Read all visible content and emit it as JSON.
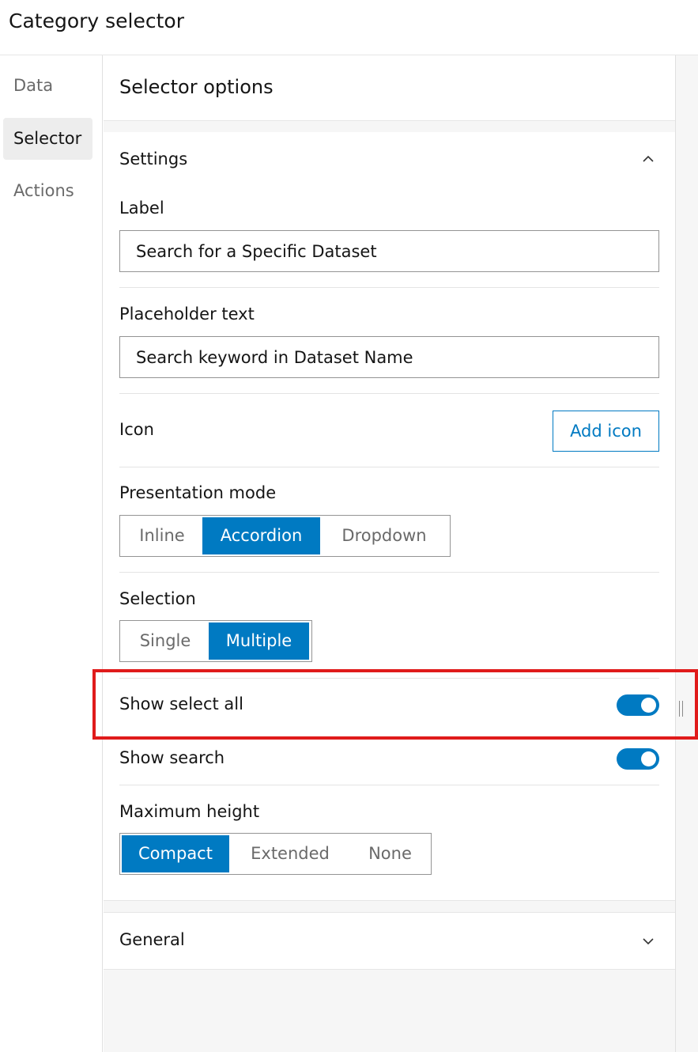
{
  "header": {
    "title": "Category selector"
  },
  "nav": {
    "items": [
      {
        "label": "Data"
      },
      {
        "label": "Selector"
      },
      {
        "label": "Actions"
      }
    ]
  },
  "panel": {
    "title": "Selector options",
    "settings": {
      "title": "Settings",
      "label_field": {
        "label": "Label",
        "value": "Search for a Specific Dataset"
      },
      "placeholder_field": {
        "label": "Placeholder text",
        "value": "Search keyword in Dataset Name"
      },
      "icon": {
        "label": "Icon",
        "button": "Add icon"
      },
      "presentation_mode": {
        "label": "Presentation mode",
        "options": [
          "Inline",
          "Accordion",
          "Dropdown"
        ],
        "selected": "Accordion"
      },
      "selection": {
        "label": "Selection",
        "options": [
          "Single",
          "Multiple"
        ],
        "selected": "Multiple"
      },
      "show_select_all": {
        "label": "Show select all",
        "on": true
      },
      "show_search": {
        "label": "Show search",
        "on": true
      },
      "maximum_height": {
        "label": "Maximum height",
        "options": [
          "Compact",
          "Extended",
          "None"
        ],
        "selected": "Compact"
      }
    },
    "general": {
      "title": "General"
    }
  },
  "colors": {
    "accent": "#007ac2",
    "highlight": "#e01b1b",
    "panel_background": "#f6f6f6",
    "text": "#151515",
    "muted_text": "#6a6a6a"
  },
  "icons": {
    "settings_chevron": "chevron-up-icon",
    "general_chevron": "chevron-down-icon",
    "resize_handle": "grip-vertical-icon"
  }
}
